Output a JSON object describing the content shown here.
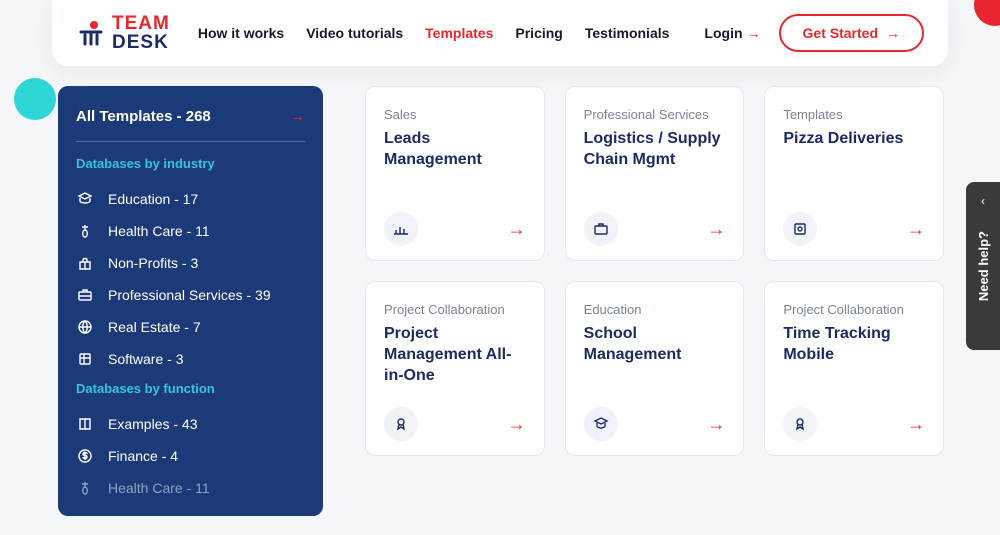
{
  "logo": {
    "line1": "TEAM",
    "line2": "DESK"
  },
  "nav": {
    "items": [
      "How it works",
      "Video tutorials",
      "Templates",
      "Pricing",
      "Testimonials"
    ],
    "active_index": 2
  },
  "login_label": "Login",
  "get_started_label": "Get Started",
  "sidebar": {
    "all_label": "All Templates - 268",
    "section1_title": "Databases by industry",
    "section2_title": "Databases by function",
    "industry": [
      {
        "icon": "education-icon",
        "label": "Education - 17"
      },
      {
        "icon": "health-icon",
        "label": "Health Care - 11"
      },
      {
        "icon": "nonprofit-icon",
        "label": "Non-Profits - 3"
      },
      {
        "icon": "briefcase-icon",
        "label": "Professional Services - 39"
      },
      {
        "icon": "globe-icon",
        "label": "Real Estate - 7"
      },
      {
        "icon": "cube-icon",
        "label": "Software - 3"
      }
    ],
    "func": [
      {
        "icon": "book-icon",
        "label": "Examples - 43"
      },
      {
        "icon": "dollar-icon",
        "label": "Finance - 4"
      },
      {
        "icon": "health-icon",
        "label": "Health Care - 11",
        "faded": true
      }
    ]
  },
  "cards": [
    {
      "cat": "Sales",
      "title": "Leads Management",
      "icon": "bar-chart-icon"
    },
    {
      "cat": "Professional Services",
      "title": "Logistics / Supply Chain Mgmt",
      "icon": "briefcase-icon"
    },
    {
      "cat": "Templates",
      "title": "Pizza Deliveries",
      "icon": "package-icon"
    },
    {
      "cat": "Project Collaboration",
      "title": "Project Management All-in-One",
      "icon": "cert-icon"
    },
    {
      "cat": "Education",
      "title": "School Management",
      "icon": "education-icon"
    },
    {
      "cat": "Project Collaboration",
      "title": "Time Tracking Mobile",
      "icon": "cert-icon"
    }
  ],
  "help_label": "Need help?"
}
